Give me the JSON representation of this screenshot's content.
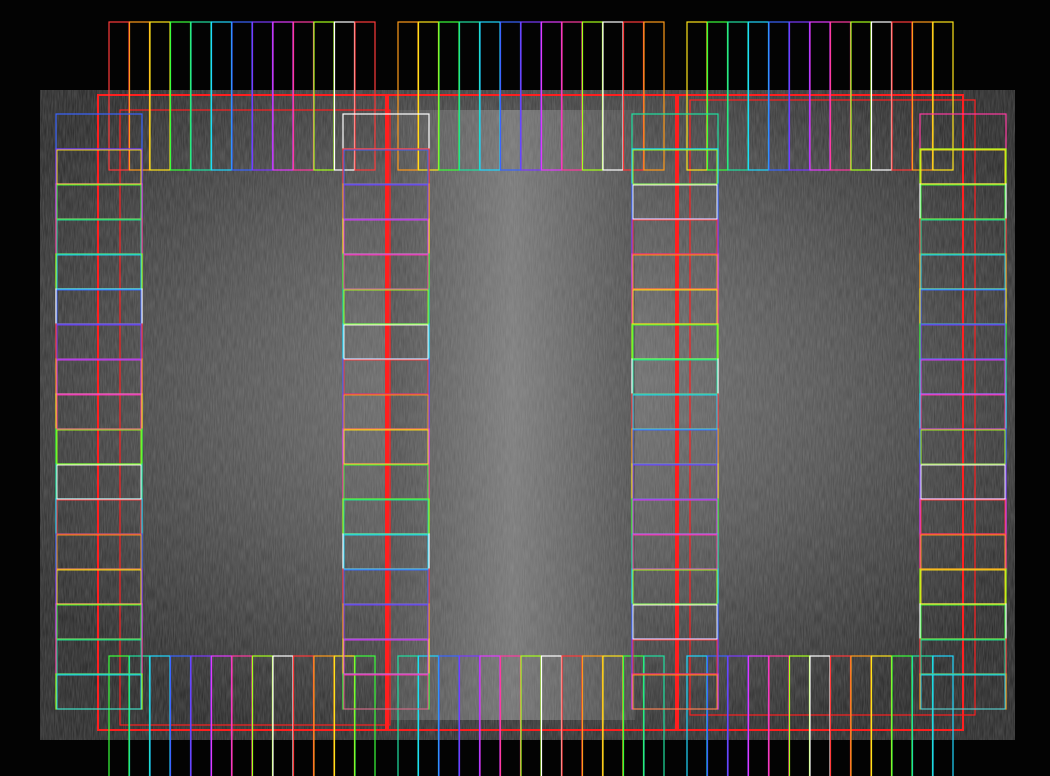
{
  "scene": {
    "kind": "grayscale micrograph with colored rectangular detection overlays",
    "background_color": "#000000",
    "die_color": "#3c3c3c",
    "die_core_color": "#5a5a5a",
    "group_frame_color": "#ff1f1f"
  },
  "palette": [
    "#ff3a3a",
    "#ff9a1a",
    "#ffe31a",
    "#3aff3a",
    "#1fe0a0",
    "#1fd8ff",
    "#3a64ff",
    "#7a3aff",
    "#e23aff",
    "#ff3aa0",
    "#a6ff1a",
    "#ffffff"
  ],
  "overlays": {
    "top_bank_groups": 3,
    "bottom_bank_groups": 3,
    "side_columns": 4,
    "pads_per_top_group": 13,
    "pads_per_bottom_group": 13,
    "pads_per_side_column": 17
  }
}
